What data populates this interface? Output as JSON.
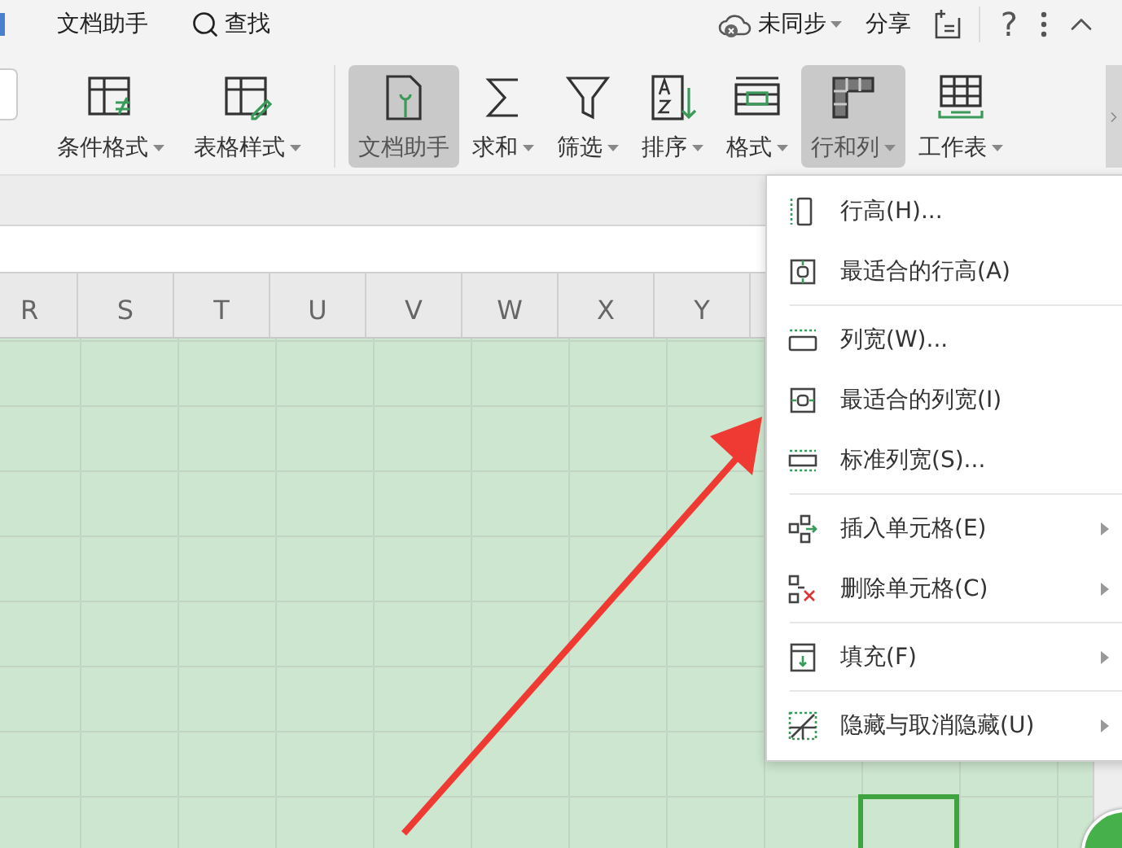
{
  "top_bar": {
    "left_items": [
      {
        "kind": "text",
        "label": "文档助手"
      },
      {
        "kind": "search",
        "label": "查找"
      }
    ],
    "sync": {
      "label": "未同步"
    },
    "share": {
      "label": "分享"
    },
    "help": {
      "label": "?"
    }
  },
  "ribbon": {
    "items": [
      {
        "label": "条件格式",
        "has_menu": true,
        "selected": false
      },
      {
        "label": "表格样式",
        "has_menu": true,
        "selected": false
      },
      {
        "label": "文档助手",
        "has_menu": false,
        "selected": true
      },
      {
        "label": "求和",
        "has_menu": true,
        "selected": false
      },
      {
        "label": "筛选",
        "has_menu": true,
        "selected": false
      },
      {
        "label": "排序",
        "has_menu": true,
        "selected": false
      },
      {
        "label": "格式",
        "has_menu": true,
        "selected": false
      },
      {
        "label": "行和列",
        "has_menu": true,
        "selected": true
      },
      {
        "label": "工作表",
        "has_menu": true,
        "selected": false
      }
    ]
  },
  "sheet": {
    "columns": [
      "R",
      "S",
      "T",
      "U",
      "V",
      "W",
      "X",
      "Y"
    ]
  },
  "menu": {
    "groups": [
      [
        {
          "label": "行高(H)...",
          "has_submenu": false
        },
        {
          "label": "最适合的行高(A)",
          "has_submenu": false
        }
      ],
      [
        {
          "label": "列宽(W)...",
          "has_submenu": false
        },
        {
          "label": "最适合的列宽(I)",
          "has_submenu": false
        },
        {
          "label": "标准列宽(S)...",
          "has_submenu": false
        }
      ],
      [
        {
          "label": "插入单元格(E)",
          "has_submenu": true
        },
        {
          "label": "删除单元格(C)",
          "has_submenu": true
        }
      ],
      [
        {
          "label": "填充(F)",
          "has_submenu": true
        }
      ],
      [
        {
          "label": "隐藏与取消隐藏(U)",
          "has_submenu": true
        }
      ]
    ]
  }
}
